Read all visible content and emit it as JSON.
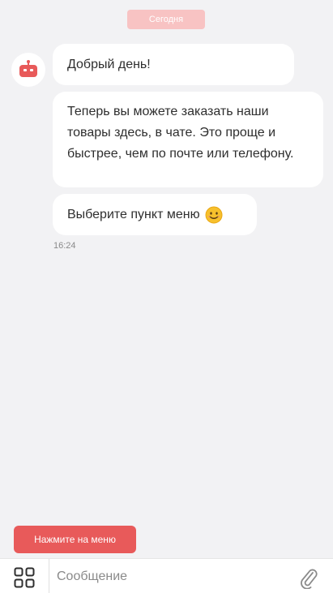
{
  "chat": {
    "date_label": "Сегодня",
    "avatar_icon": "robot-icon",
    "messages": [
      {
        "text": "Добрый день!"
      },
      {
        "text": "Теперь вы можете заказать наши товары здесь, в чате. Это проще и быстрее, чем по почте или телефону."
      },
      {
        "text": "Выберите пункт меню",
        "emoji": "smiling-face-emoji"
      }
    ],
    "time": "16:24"
  },
  "menu_button": {
    "label": "Нажмите на меню"
  },
  "composer": {
    "menu_icon": "grid-icon",
    "placeholder": "Сообщение",
    "attach_icon": "paperclip-icon"
  },
  "colors": {
    "accent": "#e85a5a",
    "date_pill": "#f8c3c3",
    "background": "#f2f2f4",
    "bubble": "#ffffff"
  }
}
